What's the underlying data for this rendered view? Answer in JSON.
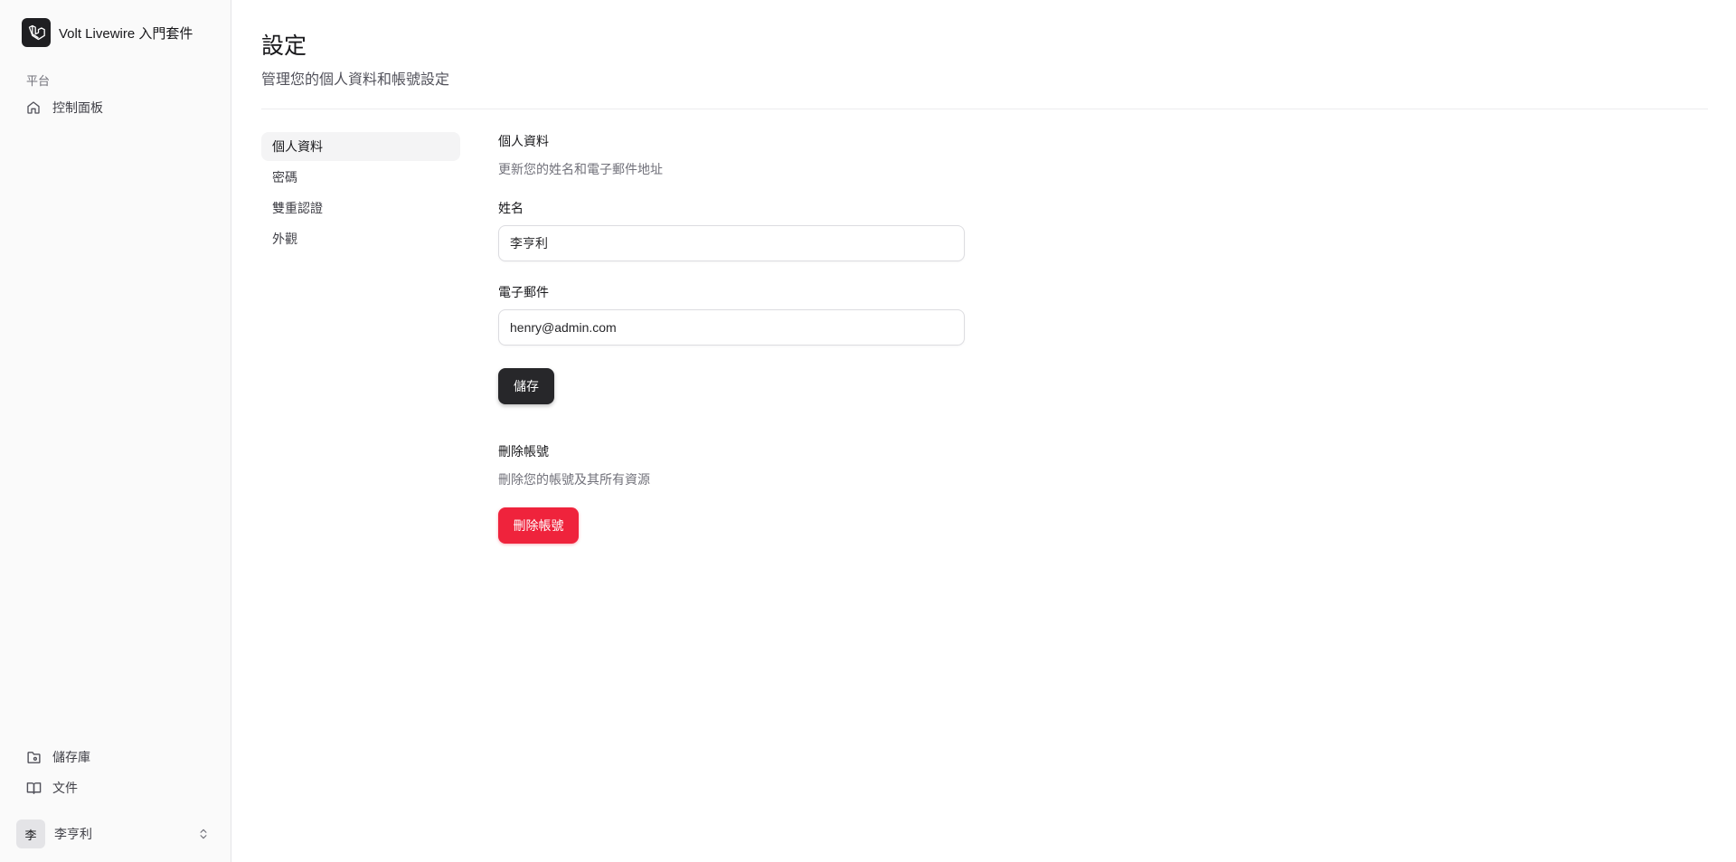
{
  "brand": {
    "name": "Volt Livewire 入門套件",
    "logo_icon": "laravel-logo-icon"
  },
  "sidebar": {
    "group_label": "平台",
    "items": [
      {
        "label": "控制面板",
        "icon": "home-icon"
      }
    ],
    "footer_items": [
      {
        "label": "儲存庫",
        "icon": "folder-git-icon"
      },
      {
        "label": "文件",
        "icon": "book-open-icon"
      }
    ],
    "user": {
      "avatar": "李",
      "name": "李亨利"
    }
  },
  "page": {
    "title": "設定",
    "subtitle": "管理您的個人資料和帳號設定"
  },
  "settings_nav": [
    {
      "label": "個人資料",
      "active": true
    },
    {
      "label": "密碼",
      "active": false
    },
    {
      "label": "雙重認證",
      "active": false
    },
    {
      "label": "外觀",
      "active": false
    }
  ],
  "profile": {
    "title": "個人資料",
    "description": "更新您的姓名和電子郵件地址",
    "name_label": "姓名",
    "name_value": "李亨利",
    "email_label": "電子郵件",
    "email_value": "henry@admin.com",
    "save_label": "儲存"
  },
  "delete_account": {
    "title": "刪除帳號",
    "description": "刪除您的帳號及其所有資源",
    "button_label": "刪除帳號"
  },
  "colors": {
    "danger": "#ef233c",
    "primary": "#27272a"
  }
}
